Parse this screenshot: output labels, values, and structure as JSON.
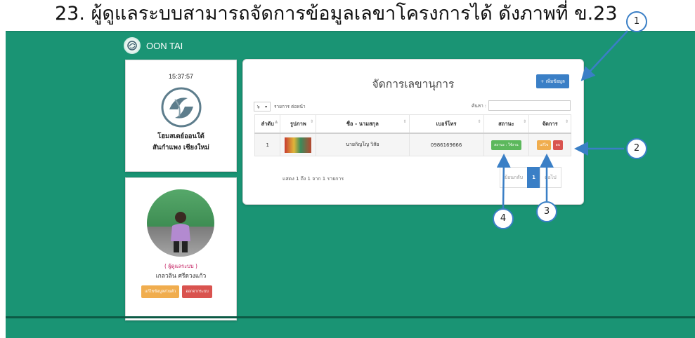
{
  "caption": "23. ผู้ดูแลระบบสามารถจัดการข้อมูลเลขาโครงการได้ ดังภาพที่ ข.23",
  "brand": {
    "name": "OON TAI"
  },
  "clock": {
    "time": "15:37:57"
  },
  "school": {
    "line1": "โฮมสเตย์ออนใต้",
    "line2": "สันกำแพง เชียงใหม่"
  },
  "profile": {
    "role": "( ผู้ดูแลระบบ )",
    "name": "เกลวลิน ศรีดวงแก้ว",
    "edit_label": "แก้ไขข้อมูลส่วนตัว",
    "logout_label": "ออกจากระบบ"
  },
  "main": {
    "title": "จัดการเลขานุการ",
    "add_label": "+ เพิ่มข้อมูล",
    "length_value": "๖",
    "length_suffix": "รายการ ต่อหน้า",
    "search_label": "ค้นหา :",
    "columns": [
      "ลำดับ",
      "รูปภาพ",
      "ชื่อ - นามสกุล",
      "เบอร์โทร",
      "สถานะ",
      "จัดการ"
    ],
    "rows": [
      {
        "index": "1",
        "name": "นายกิญโญ วิสัย",
        "phone": "0986169666",
        "status": "สถานะ : ใช้งาน",
        "edit": "แก้ไข",
        "delete": "ลบ"
      }
    ],
    "info": "แสดง 1 ถึง 1 จาก 1 รายการ",
    "pager": {
      "prev": "ย้อนกลับ",
      "page": "1",
      "next": "ต่อไป"
    }
  },
  "callouts": [
    "1",
    "2",
    "3",
    "4"
  ],
  "colors": {
    "bg": "#1a9474",
    "primary": "#3a7fc6",
    "success": "#5cb85c",
    "warning": "#f0ad4e",
    "danger": "#d9534f"
  }
}
